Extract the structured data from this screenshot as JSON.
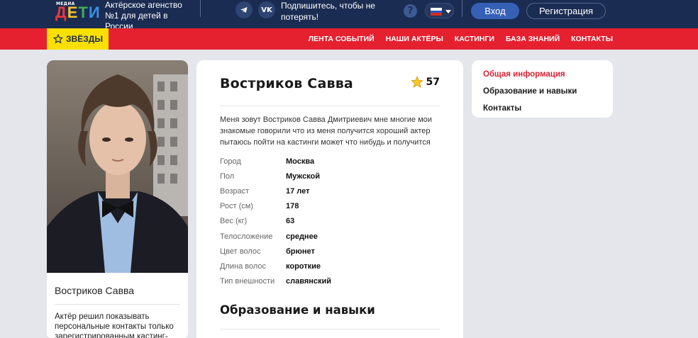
{
  "header": {
    "logo_small": "МЕДИА",
    "logo_letters": [
      "Д",
      "Е",
      "Т",
      "И"
    ],
    "agency_text": "Актёрское агенство №1 для детей в России",
    "social_icons": [
      "telegram-icon",
      "vk-icon"
    ],
    "subscribe_text": "Подпишитесь, чтобы не потерять!",
    "help_icon": "?",
    "language": "RU",
    "login_label": "Вход",
    "register_label": "Регистрация"
  },
  "nav": {
    "stars_label": "ЗВЁЗДЫ",
    "links": [
      "ЛЕНТА СОБЫТИЙ",
      "НАШИ АКТЁРЫ",
      "КАСТИНГИ",
      "БАЗА ЗНАНИЙ",
      "КОНТАКТЫ"
    ]
  },
  "profile": {
    "name": "Востриков Савва",
    "rating": "57",
    "bio": "Меня зовут Востриков Савва Дмитриевич мне многие мои знакомые говорили что из меня получится хороший актер пытаюсь пойти на кастинги может что нибудь и получится",
    "properties": [
      {
        "key": "Город",
        "value": "Москва"
      },
      {
        "key": "Пол",
        "value": "Мужской"
      },
      {
        "key": "Возраст",
        "value": "17 лет"
      },
      {
        "key": "Рост (см)",
        "value": "178"
      },
      {
        "key": "Вес (кг)",
        "value": "63"
      },
      {
        "key": "Телосложение",
        "value": "среднее"
      },
      {
        "key": "Цвет волос",
        "value": "брюнет"
      },
      {
        "key": "Длина волос",
        "value": "короткие"
      },
      {
        "key": "Тип внешности",
        "value": "славянский"
      }
    ],
    "section_education": "Образование и навыки"
  },
  "card": {
    "name": "Востриков Савва",
    "note": "Актёр решил показывать персональные контакты только зарегистрированным кастинг-"
  },
  "side_menu": {
    "items": [
      "Общая информация",
      "Образование и навыки",
      "Контакты"
    ],
    "active": 0
  },
  "colors": {
    "header_bg": "#1b2c52",
    "nav_red": "#e5202f",
    "stars_yellow": "#f9e000",
    "active_red": "#d72233"
  }
}
